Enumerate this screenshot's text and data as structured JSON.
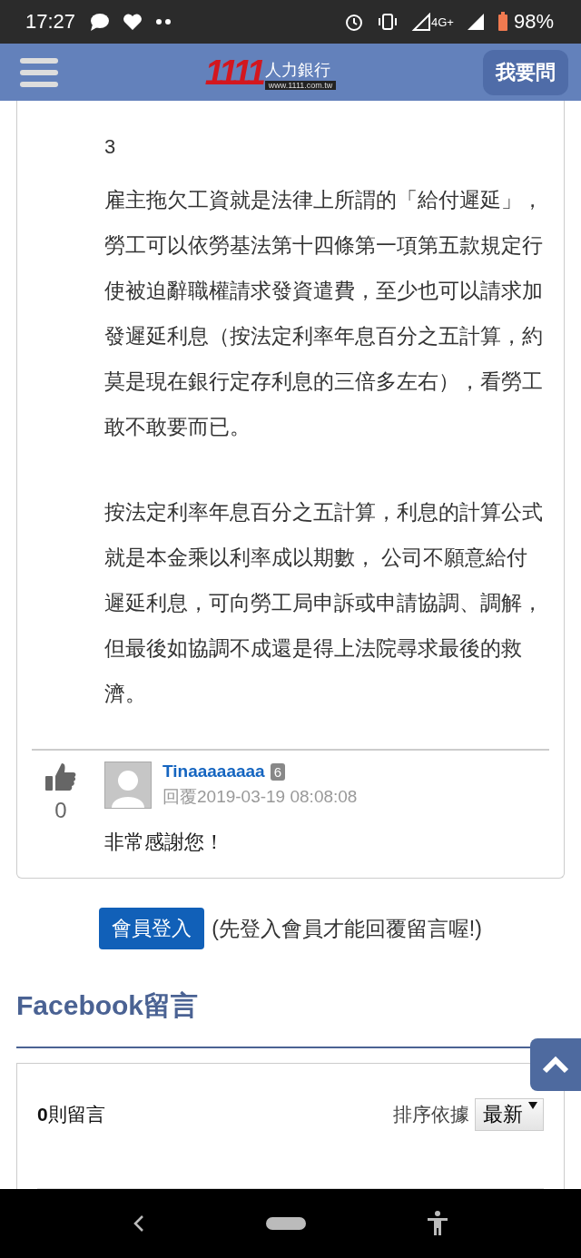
{
  "status_bar": {
    "time": "17:27",
    "network": "4G+",
    "battery": "98%"
  },
  "header": {
    "logo": {
      "number": "1111",
      "name": "人力銀行",
      "url": "www.1111.com.tw"
    },
    "ask_button": "我要問"
  },
  "answer": {
    "number": "3",
    "paragraphs": [
      "雇主拖欠工資就是法律上所謂的「給付遲延」，勞工可以依勞基法第十四條第一項第五款規定行使被迫辭職權請求發資遣費，至少也可以請求加發遲延利息（按法定利率年息百分之五計算，約莫是現在銀行定存利息的三倍多左右），看勞工敢不敢要而已。",
      "按法定利率年息百分之五計算，利息的計算公式就是本金乘以利率成以期數， 公司不願意給付遲延利息，可向勞工局申訴或申請協調、調解，但最後如協調不成還是得上法院尋求最後的救濟。"
    ]
  },
  "reply": {
    "likes": "0",
    "user": "Tinaaaaaaaa",
    "level": "6",
    "date": "回覆2019-03-19 08:08:08",
    "text": "非常感謝您！"
  },
  "login": {
    "button": "會員登入",
    "note": "(先登入會員才能回覆留言喔!)"
  },
  "facebook": {
    "title": "Facebook留言",
    "count": "0",
    "count_label": "則留言",
    "sort_label": "排序依據",
    "sort_value": "最新"
  }
}
